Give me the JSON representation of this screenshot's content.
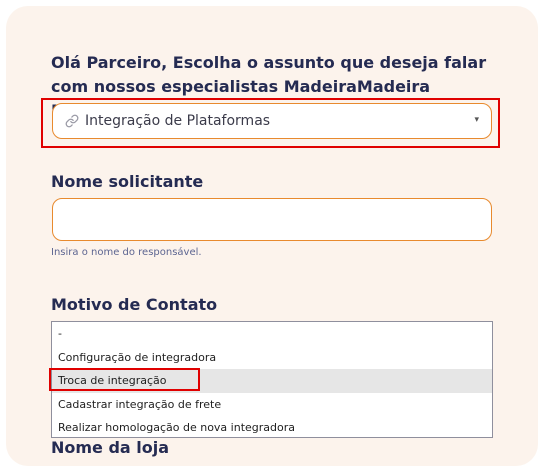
{
  "intro_text": "Olá Parceiro, Escolha o assunto que deseja falar com nossos especialistas MadeiraMadeira Marketplace.",
  "topic_select": {
    "icon": "link-icon",
    "value": "Integração de Plataformas",
    "arrow": "▾"
  },
  "requester": {
    "label": "Nome solicitante",
    "value": "",
    "placeholder": "",
    "helper": "Insira o nome do responsável."
  },
  "contact_reason": {
    "label": "Motivo de Contato",
    "options": [
      "-",
      "Configuração de integradora",
      "Troca de integração",
      "Cadastrar integração de frete",
      "Realizar homologação de nova integradora"
    ],
    "hovered_option": "Troca de integração"
  },
  "next_field_label": "Nome da loja",
  "colors": {
    "accent": "#e88a2e",
    "heading": "#252b52",
    "card_background": "#fcf3ec",
    "highlight": "#e00000"
  }
}
